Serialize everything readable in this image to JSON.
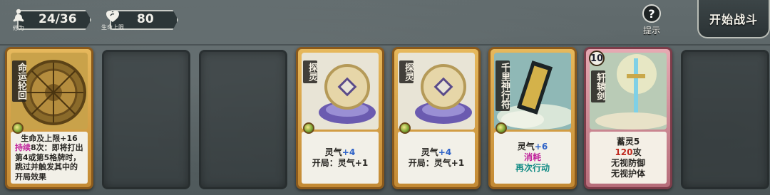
{
  "stats": {
    "cultivation": {
      "label": "修为",
      "value": "24/36",
      "icon": "meditation-icon"
    },
    "max_life": {
      "label": "生命上限",
      "value": "80",
      "icon": "heart-icon"
    }
  },
  "help": {
    "label": "提示",
    "glyph": "?"
  },
  "start_button": {
    "label": "开始战斗"
  },
  "cards": [
    {
      "name": "命运轮回",
      "lines": [
        "生命及上限+16",
        "持续8次：即将打出第4或第5格牌时，跳过并触发其中的开局效果"
      ],
      "line_parts": {
        "a": "生命及上限+16",
        "b_hl": "持续",
        "b_rest": "8次：即将打出第4或第5格牌时，跳过并触发其中的开局效果"
      }
    },
    {
      "name": "探灵",
      "effect_label": "灵气",
      "effect_value": "+4",
      "line2": "开局：灵气+1"
    },
    {
      "name": "探灵",
      "effect_label": "灵气",
      "effect_value": "+4",
      "line2": "开局：灵气+1"
    },
    {
      "name": "千里神行符",
      "effect_label": "灵气",
      "effect_value": "+6",
      "line2": "消耗",
      "line3": "再次行动"
    },
    {
      "name": "轩辕剑",
      "cost": "10",
      "line1": "蓄灵5",
      "atk_value": "120",
      "atk_label": "攻",
      "line3": "无视防御",
      "line4": "无视护体"
    }
  ],
  "colors": {
    "accent_blue": "#2f63c8",
    "accent_pink": "#c0249c",
    "accent_teal": "#108a84",
    "accent_red": "#c02a1f",
    "card_gold": "#e6b85c",
    "card_pink": "#e6a9b2"
  }
}
